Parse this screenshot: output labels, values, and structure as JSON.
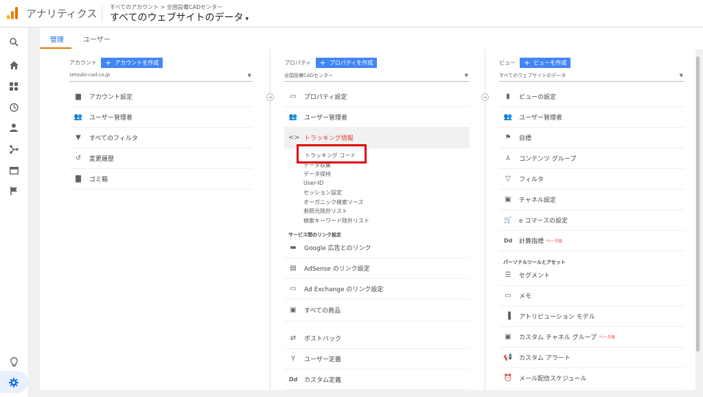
{
  "header": {
    "app_title": "アナリティクス",
    "breadcrumb": "すべてのアカウント > 全国設備CADセンター",
    "property_view": "すべてのウェブサイトのデータ"
  },
  "tabs": [
    {
      "label": "管理",
      "active": true
    },
    {
      "label": "ユーザー",
      "active": false
    }
  ],
  "left_nav": {
    "icons": [
      "search-icon",
      "home-icon",
      "customization-icon",
      "realtime-clock-icon",
      "audience-person-icon",
      "acquisition-icon",
      "behavior-icon",
      "conversions-flag-icon",
      "discover-lightbulb-icon",
      "admin-gear-icon"
    ]
  },
  "account": {
    "heading": "アカウント",
    "create_label": "アカウントを作成",
    "selected": "setsubi-cad.co.jp",
    "items": [
      {
        "label": "アカウント設定",
        "icon": "building-icon"
      },
      {
        "label": "ユーザー管理者",
        "icon": "users-icon"
      },
      {
        "label": "すべてのフィルタ",
        "icon": "filter-icon"
      },
      {
        "label": "変更履歴",
        "icon": "history-icon"
      },
      {
        "label": "ゴミ箱",
        "icon": "trash-icon"
      }
    ]
  },
  "property": {
    "heading": "プロパティ",
    "create_label": "プロパティを作成",
    "selected": "全国設備CADセンター",
    "items": [
      {
        "label": "プロパティ設定",
        "icon": "property-settings-icon"
      },
      {
        "label": "ユーザー管理者",
        "icon": "users-icon"
      },
      {
        "label": "トラッキング情報",
        "icon": "code-icon"
      }
    ],
    "tracking_sub": [
      "トラッキング コード",
      "データ収集",
      "データ保持",
      "User-ID",
      "セッション設定",
      "オーガニック検索ソース",
      "参照元除外リスト",
      "検索キーワード除外リスト"
    ],
    "linking_heading": "サービス間のリンク設定",
    "link_items": [
      {
        "label": "Google 広告とのリンク",
        "icon": "google-ads-icon"
      },
      {
        "label": "AdSense のリンク設定",
        "icon": "adsense-icon"
      },
      {
        "label": "Ad Exchange のリンク設定",
        "icon": "ad-exchange-icon"
      },
      {
        "label": "すべての商品",
        "icon": "all-products-icon"
      },
      {
        "label": "ポストバック",
        "icon": "postback-icon"
      },
      {
        "label": "ユーザー定義",
        "icon": "user-defined-icon"
      },
      {
        "label": "カスタム定義",
        "icon": "custom-definitions-icon"
      }
    ]
  },
  "view": {
    "heading": "ビュー",
    "create_label": "ビューを作成",
    "selected": "すべてのウェブサイトのデータ",
    "items": [
      {
        "label": "ビューの設定",
        "icon": "document-icon"
      },
      {
        "label": "ユーザー管理者",
        "icon": "users-icon"
      },
      {
        "label": "目標",
        "icon": "goal-flag-icon"
      },
      {
        "label": "コンテンツ グループ",
        "icon": "content-group-icon"
      },
      {
        "label": "フィルタ",
        "icon": "filter-icon"
      },
      {
        "label": "チャネル設定",
        "icon": "channel-icon"
      },
      {
        "label": "e コマースの設定",
        "icon": "cart-icon"
      },
      {
        "label": "計算指標",
        "icon": "calculated-metrics-icon",
        "badge": "ベータ版"
      }
    ],
    "personal_heading": "パーソナルツールとアセット",
    "personal_items": [
      {
        "label": "セグメント",
        "icon": "segment-icon"
      },
      {
        "label": "メモ",
        "icon": "annotation-icon"
      },
      {
        "label": "アトリビューション モデル",
        "icon": "attribution-icon"
      },
      {
        "label": "カスタム チャネル グループ",
        "icon": "custom-channel-icon",
        "badge": "ベータ版"
      },
      {
        "label": "カスタム アラート",
        "icon": "alert-megaphone-icon"
      },
      {
        "label": "メール配信スケジュール",
        "icon": "schedule-icon"
      }
    ]
  },
  "highlight_color": "#e00000"
}
